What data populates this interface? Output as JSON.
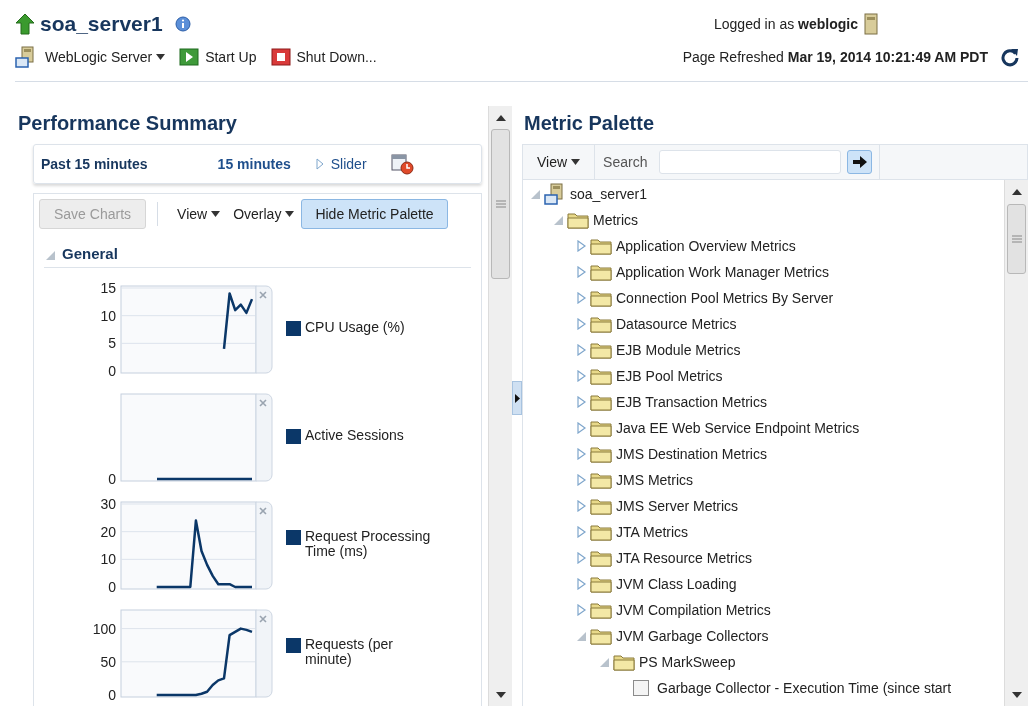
{
  "header": {
    "title": "soa_server1",
    "user": "Logged in as **weblogic**",
    "menu": "WebLogic Server",
    "actions": [
      {
        "label": "Start Up",
        "kind": "start"
      },
      {
        "label": "Shut Down...",
        "kind": "stop"
      }
    ],
    "refreshed": "Page Refreshed **Mar 19, 2014 10:21:49 AM PDT**"
  },
  "performance": {
    "title": "Performance Summary",
    "time_range": {
      "label": "Past 15 minutes",
      "window": "15 minutes",
      "slider": "Slider"
    },
    "toolbar": {
      "save": {
        "label": "Save Charts",
        "disabled": true
      },
      "view": "View",
      "overlay": "Overlay",
      "palette_button": {
        "label": "Hide Metric Palette",
        "selected": true
      }
    },
    "section": {
      "label": "General",
      "expanded": true
    },
    "charts": [
      {
        "chart_data": {
          "type": "line",
          "ylim": [
            0,
            15
          ],
          "yticks": [
            0,
            5,
            10,
            15
          ],
          "series": [
            {
              "name": "CPU Usage (%)",
              "color": "#0b3768",
              "values": [
                null,
                null,
                null,
                null,
                null,
                null,
                null,
                null,
                null,
                null,
                null,
                null,
                null,
                null,
                null,
                null,
                null,
                null,
                4,
                14,
                11,
                12,
                10.5,
                13
              ]
            }
          ]
        }
      },
      {
        "kind": "sparkline",
        "legend": "Active Sessions",
        "axis_label": "0",
        "color": "#0b3768"
      },
      {
        "chart_data": {
          "type": "line",
          "ylim": [
            0,
            30
          ],
          "yticks": [
            0,
            10,
            20,
            30
          ],
          "series": [
            {
              "name": "Request Processing Time (ms)",
              "color": "#0b3768",
              "values": [
                null,
                null,
                null,
                null,
                null,
                null,
                0,
                0,
                0,
                0,
                0,
                0,
                0,
                24,
                13,
                8,
                4,
                1,
                1,
                1,
                0,
                0,
                0,
                0
              ]
            }
          ]
        }
      },
      {
        "chart_data": {
          "type": "line",
          "ylim": [
            0,
            125
          ],
          "yticks": [
            0,
            50,
            100
          ],
          "series": [
            {
              "name": "Requests (per minute)",
              "color": "#0b3768",
              "values": [
                null,
                null,
                null,
                null,
                null,
                null,
                0,
                0,
                0,
                0,
                0,
                0,
                0,
                0,
                2,
                5,
                15,
                22,
                25,
                90,
                95,
                100,
                98,
                95
              ]
            }
          ]
        }
      }
    ]
  },
  "palette": {
    "title": "Metric Palette",
    "view": "View",
    "search_label": "Search",
    "tree": [
      {
        "label": "soa_server1",
        "kind": "server",
        "expanded": true,
        "children": [
          {
            "label": "Metrics",
            "kind": "folder",
            "expanded": true,
            "children": [
              {
                "label": "Application Overview Metrics",
                "kind": "folder",
                "expanded": false
              },
              {
                "label": "Application Work Manager Metrics",
                "kind": "folder",
                "expanded": false
              },
              {
                "label": "Connection Pool Metrics By Server",
                "kind": "folder",
                "expanded": false
              },
              {
                "label": "Datasource Metrics",
                "kind": "folder",
                "expanded": false
              },
              {
                "label": "EJB Module Metrics",
                "kind": "folder",
                "expanded": false
              },
              {
                "label": "EJB Pool Metrics",
                "kind": "folder",
                "expanded": false
              },
              {
                "label": "EJB Transaction Metrics",
                "kind": "folder",
                "expanded": false
              },
              {
                "label": "Java EE Web Service Endpoint Metrics",
                "kind": "folder",
                "expanded": false
              },
              {
                "label": "JMS Destination Metrics",
                "kind": "folder",
                "expanded": false
              },
              {
                "label": "JMS Metrics",
                "kind": "folder",
                "expanded": false
              },
              {
                "label": "JMS Server Metrics",
                "kind": "folder",
                "expanded": false
              },
              {
                "label": "JTA Metrics",
                "kind": "folder",
                "expanded": false
              },
              {
                "label": "JTA Resource Metrics",
                "kind": "folder",
                "expanded": false
              },
              {
                "label": "JVM Class Loading",
                "kind": "folder",
                "expanded": false
              },
              {
                "label": "JVM Compilation Metrics",
                "kind": "folder",
                "expanded": false
              },
              {
                "label": "JVM Garbage Collectors",
                "kind": "folder",
                "expanded": true,
                "children": [
                  {
                    "label": "PS MarkSweep",
                    "kind": "folder",
                    "expanded": true,
                    "children": [
                      {
                        "label": "Garbage Collector - Execution Time (since start",
                        "kind": "metric",
                        "checked": false
                      }
                    ]
                  }
                ]
              }
            ]
          }
        ]
      }
    ]
  }
}
